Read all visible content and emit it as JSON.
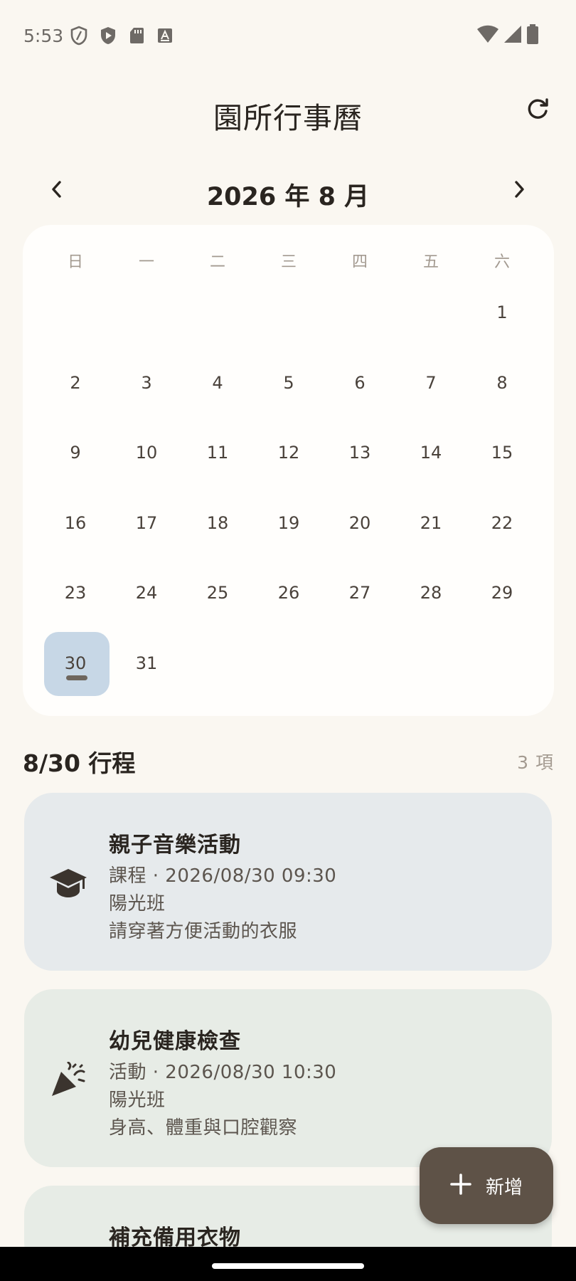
{
  "status_bar": {
    "time": "5:53",
    "icons_left": [
      "shield-icon",
      "play-shield-icon",
      "sd-card-icon",
      "font-a-icon"
    ],
    "icons_right": [
      "wifi-icon",
      "signal-icon",
      "battery-icon"
    ]
  },
  "header": {
    "title": "園所行事曆",
    "refresh_icon": "refresh-icon"
  },
  "month_nav": {
    "label": "2026 年 8 月",
    "prev_icon": "chevron-left-icon",
    "next_icon": "chevron-right-icon"
  },
  "calendar": {
    "weekdays": [
      "日",
      "一",
      "二",
      "三",
      "四",
      "五",
      "六"
    ],
    "leading_blanks": 6,
    "days": [
      "1",
      "2",
      "3",
      "4",
      "5",
      "6",
      "7",
      "8",
      "9",
      "10",
      "11",
      "12",
      "13",
      "14",
      "15",
      "16",
      "17",
      "18",
      "19",
      "20",
      "21",
      "22",
      "23",
      "24",
      "25",
      "26",
      "27",
      "28",
      "29",
      "30",
      "31"
    ],
    "selected_day": "30",
    "event_days": [
      "30"
    ],
    "selected_color": "#C7D7E6"
  },
  "schedule": {
    "title": "8/30 行程",
    "count": "3 項"
  },
  "events": [
    {
      "title": "親子音樂活動",
      "meta": "課程 · 2026/08/30 09:30",
      "class": "陽光班",
      "note": "請穿著方便活動的衣服",
      "icon": "graduation-cap-icon",
      "bg_color": "#E6EAEC"
    },
    {
      "title": "幼兒健康檢查",
      "meta": "活動 · 2026/08/30 10:30",
      "class": "陽光班",
      "note": "身高、體重與口腔觀察",
      "icon": "party-popper-icon",
      "bg_color": "#E7ECE6"
    },
    {
      "title": "補充備用衣物",
      "bg_color": "#E7ECE6"
    }
  ],
  "fab": {
    "label": "新增",
    "icon": "plus-icon",
    "color": "#5E5247"
  },
  "colors": {
    "background": "#FAF7F1",
    "card": "#FFFEFC",
    "text_primary": "#2A2520",
    "text_muted": "#A39A90"
  }
}
